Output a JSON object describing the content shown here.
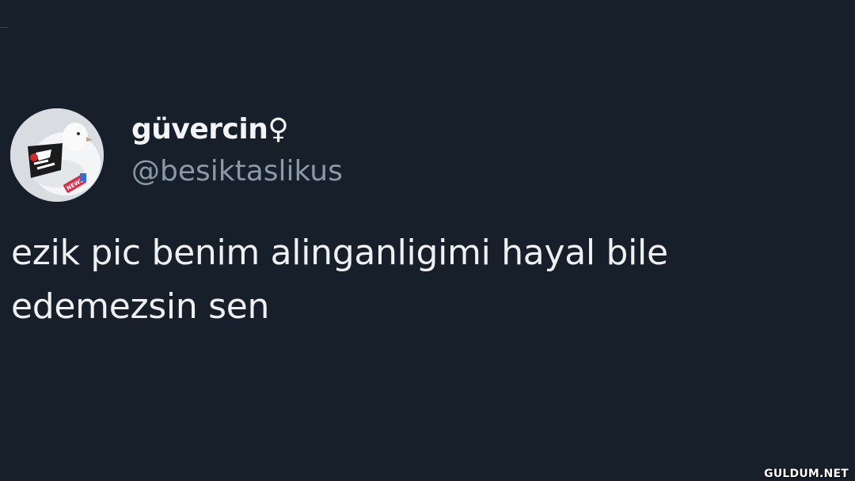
{
  "tweet": {
    "display_name": "güvercin♀",
    "handle": "@besiktaslikus",
    "text_lines": [
      "ezik pic benim alinganligimi hayal bile",
      "edemezsin sen"
    ]
  },
  "avatar": {
    "icon": "pigeon-avatar-icon",
    "badge_text": "NEWS"
  },
  "watermark": "GULDUM.NET",
  "colors": {
    "background": "#17202a",
    "primary_text": "#e7e9ea",
    "secondary_text": "#8b98a5"
  }
}
